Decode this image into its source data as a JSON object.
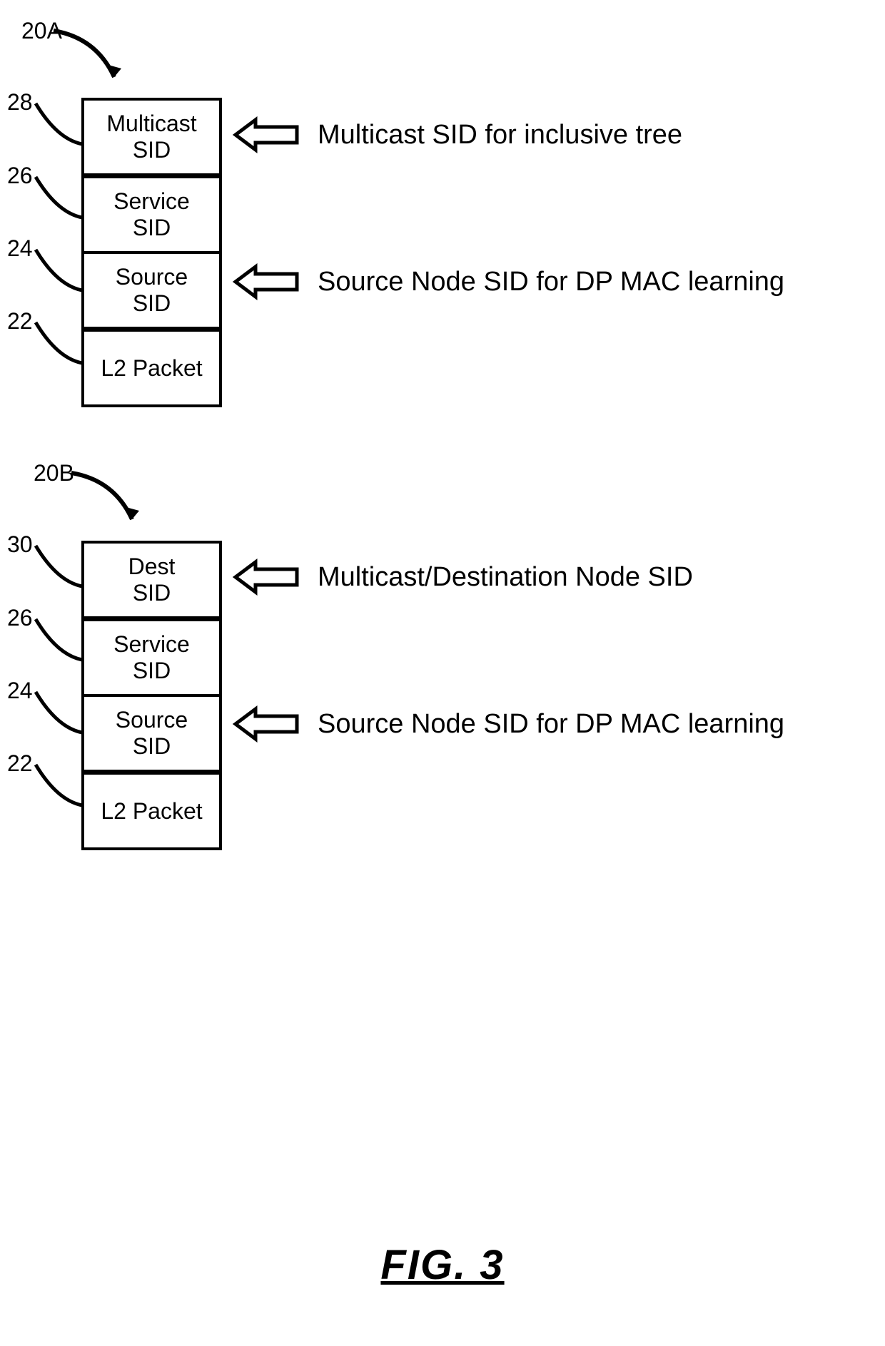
{
  "figure_label": "FIG. 3",
  "diagram_a": {
    "id_label": "20A",
    "rows": {
      "multicast": {
        "num": "28",
        "line1": "Multicast",
        "line2": "SID"
      },
      "service": {
        "num": "26",
        "line1": "Service",
        "line2": "SID"
      },
      "source": {
        "num": "24",
        "line1": "Source",
        "line2": "SID"
      },
      "l2": {
        "num": "22",
        "line1": "L2 Packet"
      }
    },
    "annotations": {
      "top": "Multicast SID for inclusive tree",
      "source": "Source Node SID for DP MAC learning"
    }
  },
  "diagram_b": {
    "id_label": "20B",
    "rows": {
      "dest": {
        "num": "30",
        "line1": "Dest",
        "line2": "SID"
      },
      "service": {
        "num": "26",
        "line1": "Service",
        "line2": "SID"
      },
      "source": {
        "num": "24",
        "line1": "Source",
        "line2": "SID"
      },
      "l2": {
        "num": "22",
        "line1": "L2 Packet"
      }
    },
    "annotations": {
      "top": "Multicast/Destination Node SID",
      "source": "Source Node SID for DP MAC learning"
    }
  }
}
